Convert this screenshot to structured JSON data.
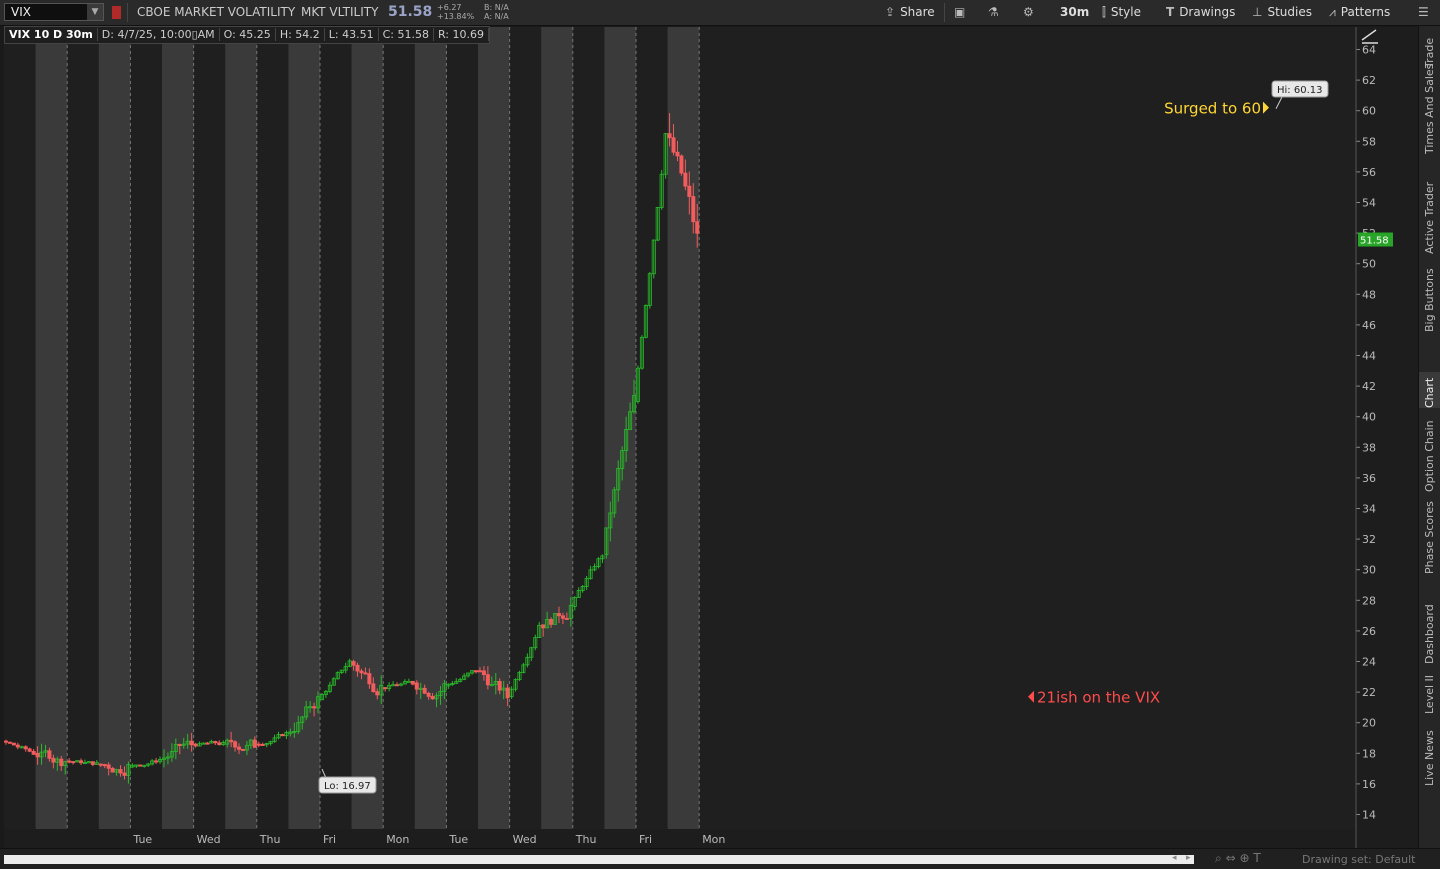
{
  "topbar": {
    "symbol": "VIX",
    "description": "CBOE MARKET VOLATILITY",
    "short_name": "MKT VLTILITY",
    "last": "51.58",
    "change_abs": "+6.27",
    "change_pct": "+13.84%",
    "bid": "B: N/A",
    "ask": "A: N/A",
    "share_label": "Share",
    "timeframe_label": "30m",
    "style_label": "Style",
    "drawings_label": "Drawings",
    "studies_label": "Studies",
    "patterns_label": "Patterns"
  },
  "infobar": {
    "title": "VIX 10 D 30m",
    "date": "D: 4/7/25, 10:00▯AM",
    "open": "O: 45.25",
    "high": "H: 54.2",
    "low": "L: 43.51",
    "close": "C: 51.58",
    "range": "R: 10.69"
  },
  "right_tabs": [
    "Trade",
    "Times And Sales",
    "Active Trader",
    "Big Buttons",
    "Chart",
    "Option Chain",
    "Phase Scores",
    "Dashboard",
    "Level II",
    "Live News"
  ],
  "bottom": {
    "drawing_set": "Drawing set: Default"
  },
  "colors": {
    "up": "#29b929",
    "down": "#f25c5c",
    "background": "#1a1a1a",
    "band_light": "#3a3a3a",
    "band_dark": "#1f1f1f",
    "price_tag": "#28a528",
    "annotation_yellow": "#ffd633",
    "annotation_red": "#ff4c4c"
  },
  "chart_data": {
    "type": "candlestick",
    "symbol": "VIX",
    "interval": "30m",
    "period": "10 D",
    "yticks": [
      14,
      16,
      18,
      20,
      22,
      24,
      26,
      28,
      30,
      32,
      34,
      36,
      38,
      40,
      42,
      44,
      46,
      48,
      50,
      52,
      54,
      56,
      58,
      60,
      62,
      64
    ],
    "ylim": [
      13,
      65
    ],
    "x_day_labels": [
      "Tue",
      "Wed",
      "Thu",
      "Fri",
      "Mon",
      "Tue",
      "Wed",
      "Thu",
      "Fri",
      "Mon"
    ],
    "last_price": "51.58",
    "high_label": "Hi: 60.13",
    "low_label": "Lo: 16.97",
    "annotations": [
      {
        "text": "Surged to 60",
        "price": 60.2,
        "color": "#ffd633"
      },
      {
        "text": "21ish on the VIX",
        "price": 21.7,
        "color": "#ff4c4c"
      }
    ],
    "days": [
      {
        "label": "Thu",
        "ext_close": 19.0,
        "rth_close": 18.8
      },
      {
        "label": "Tue",
        "ext_close": 18.0,
        "rth_close": 17.5
      },
      {
        "label": "Wed",
        "ext_close": 17.3,
        "rth_close": 17.1
      },
      {
        "label": "Thu",
        "ext_close": 17.6,
        "rth_close": 18.6
      },
      {
        "label": "Fri",
        "ext_close": 18.6,
        "rth_close": 18.6
      },
      {
        "label": "Mon",
        "ext_close": 19.3,
        "rth_close": 21.5
      },
      {
        "label": "Tue",
        "ext_close": 24.0,
        "rth_close": 22.3
      },
      {
        "label": "Wed",
        "ext_close": 22.6,
        "rth_close": 22.4
      },
      {
        "label": "Thu",
        "ext_close": 23.4,
        "rth_close": 21.7
      },
      {
        "label": "Fri",
        "ext_close": 26.4,
        "rth_close": 27.6
      },
      {
        "label": "Mon",
        "ext_close": 31.0,
        "rth_close": 41.0
      },
      {
        "label": "Tue",
        "ext_close": 58.5,
        "rth_close": 51.58
      }
    ]
  }
}
